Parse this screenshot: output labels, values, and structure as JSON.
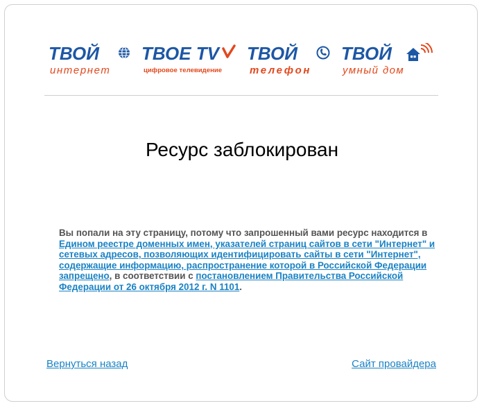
{
  "logos": [
    {
      "name": "internet",
      "top": "ТВОЙ",
      "bottom": "интернет"
    },
    {
      "name": "tv",
      "top": "ТВОЕ ТV",
      "bottom": "цифровое телевидение"
    },
    {
      "name": "phone",
      "top": "ТВОЙ",
      "bottom": "телефон"
    },
    {
      "name": "smarthome",
      "top": "ТВОЙ",
      "bottom": "умный дом"
    }
  ],
  "colors": {
    "brand_blue": "#1d57a5",
    "brand_orange": "#e2481d",
    "link": "#1a82c4",
    "text": "#545454"
  },
  "page": {
    "title": "Ресурс заблокирован"
  },
  "message": {
    "part1": "Вы попали на эту страницу, потому что запрошенный вами ресурс находится в ",
    "registry_link": "Едином реестре доменных имен, указателей страниц сайтов в сети \"Интернет\" и сетевых адресов, позволяющих идентифицировать сайты в сети \"Интернет\", содержащие информацию, распространение которой в Российской Федерации запрещено",
    "part2": ", в соответствии с ",
    "decree_link": "постановлением Правительства Российской Федерации от 26 октября 2012 г. N 1101",
    "part3": "."
  },
  "footer": {
    "back_label": "Вернуться назад",
    "provider_label": "Сайт провайдера"
  }
}
